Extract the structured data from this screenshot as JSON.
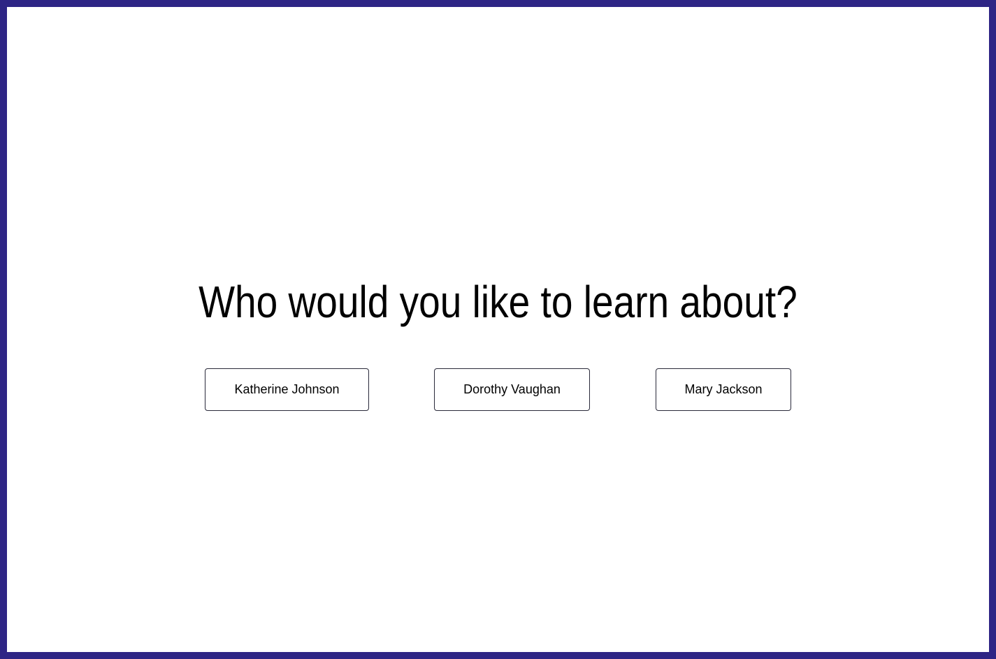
{
  "prompt": {
    "question": "Who would you like to learn about?"
  },
  "choices": [
    {
      "label": "Katherine Johnson"
    },
    {
      "label": "Dorothy Vaughan"
    },
    {
      "label": "Mary Jackson"
    }
  ],
  "colors": {
    "frame_border": "#2e2585",
    "background": "#ffffff",
    "text": "#000000",
    "button_border": "#2a2a3a"
  }
}
